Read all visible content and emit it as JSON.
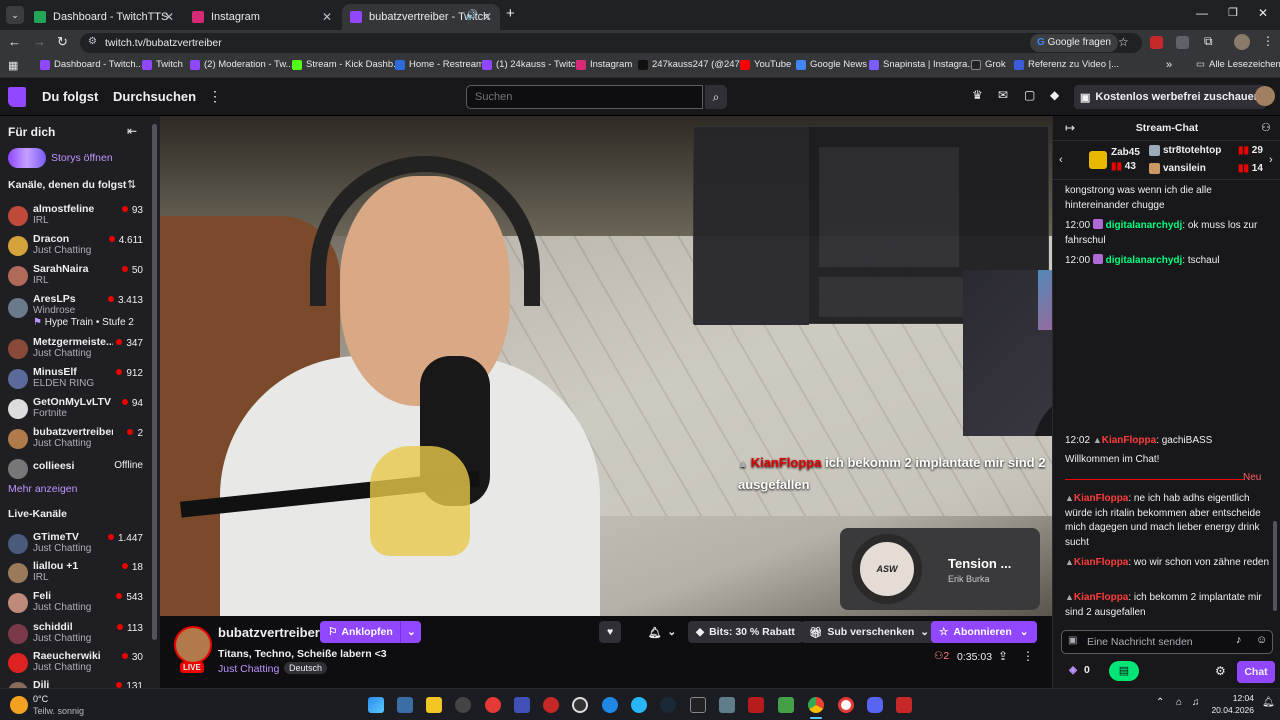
{
  "browser": {
    "tabs": [
      {
        "label": "Dashboard - TwitchTTS",
        "color": "#23a559"
      },
      {
        "label": "Instagram",
        "color": "#d62976"
      },
      {
        "label": "bubatzvertreiber - Twitch",
        "color": "#9146ff"
      }
    ],
    "url": "twitch.tv/bubatzvertreiber",
    "google_button": "Google fragen",
    "bookmarks": [
      {
        "label": "Dashboard - Twitch...",
        "color": "#9146ff"
      },
      {
        "label": "Twitch",
        "color": "#9146ff"
      },
      {
        "label": "(2) Moderation - Tw...",
        "color": "#9146ff"
      },
      {
        "label": "Stream - Kick Dashb...",
        "color": "#53fc18"
      },
      {
        "label": "Home - Restream",
        "color": "#2d6cdf"
      },
      {
        "label": "(1) 24kauss - Twitch",
        "color": "#9146ff"
      },
      {
        "label": "Instagram",
        "color": "#d62976"
      },
      {
        "label": "247kauss247 (@247...",
        "color": "#111111"
      },
      {
        "label": "YouTube",
        "color": "#ff0000"
      },
      {
        "label": "Google News",
        "color": "#4285f4"
      },
      {
        "label": "Snapinsta | Instagra...",
        "color": "#7b5cff"
      },
      {
        "label": "Grok",
        "color": "#222222"
      },
      {
        "label": "Referenz zu Video |...",
        "color": "#3b5bdb"
      }
    ],
    "all_bookmarks": "Alle Lesezeichen"
  },
  "twitch": {
    "nav": {
      "following": "Du folgst",
      "browse": "Durchsuchen",
      "search_placeholder": "Suchen",
      "ad_free": "Kostenlos werbefrei zuschauen"
    },
    "sidebar": {
      "for_you": "Für dich",
      "stories": "Storys öffnen",
      "followed_title": "Kanäle, denen du folgst",
      "followed": [
        {
          "name": "almostfeline",
          "category": "IRL",
          "viewers": "93",
          "color": "#c04a3a"
        },
        {
          "name": "Dracon",
          "category": "Just Chatting",
          "viewers": "4.611",
          "color": "#d4a23a"
        },
        {
          "name": "SarahNaira",
          "category": "IRL",
          "viewers": "50",
          "color": "#b06a5a"
        },
        {
          "name": "AresLPs",
          "category": "Windrose",
          "viewers": "3.413",
          "color": "#6a7a8a",
          "extra": "Hype Train • Stufe 2"
        },
        {
          "name": "Metzgermeiste...",
          "category": "Just Chatting",
          "viewers": "347",
          "color": "#8a4a3a"
        },
        {
          "name": "MinusElf",
          "category": "ELDEN RING",
          "viewers": "912",
          "color": "#5a6a9a"
        },
        {
          "name": "GetOnMyLvLTV",
          "category": "Fortnite",
          "viewers": "94",
          "color": "#dddddd"
        },
        {
          "name": "bubatzvertreiber",
          "category": "Just Chatting",
          "viewers": "2",
          "color": "#b07a4a"
        },
        {
          "name": "collieesi",
          "category": "",
          "viewers": "Offline",
          "color": "#777777"
        }
      ],
      "show_more": "Mehr anzeigen",
      "live_title": "Live-Kanäle",
      "live": [
        {
          "name": "GTimeTV",
          "category": "Just Chatting",
          "viewers": "1.447",
          "color": "#4a5a7a"
        },
        {
          "name": "liallou +1",
          "category": "IRL",
          "viewers": "18",
          "color": "#9a7a5a"
        },
        {
          "name": "Feli",
          "category": "Just Chatting",
          "viewers": "543",
          "color": "#c08a7a"
        },
        {
          "name": "schiddil",
          "category": "Just Chatting",
          "viewers": "113",
          "color": "#7a3a4a"
        },
        {
          "name": "Raeucherwiki",
          "category": "Just Chatting",
          "viewers": "30",
          "color": "#dd2222"
        },
        {
          "name": "Dili",
          "category": "",
          "viewers": "131",
          "color": "#8a6a5a"
        }
      ]
    },
    "video": {
      "overlay_user": "KianFloppa",
      "overlay_msg": "ich bekomm 2 implantate mir sind 2 ausgefallen",
      "song_title": "Tension ...",
      "song_artist": "Erik Burka",
      "song_logo": "ASW"
    },
    "stream": {
      "channel": "bubatzvertreiber",
      "title": "Titans, Techno, Scheiße labern <3",
      "category": "Just Chatting",
      "tag": "Deutsch",
      "live": "LIVE",
      "knock": "Anklopfen",
      "bits": "Bits: 30 % Rabatt",
      "gift": "Sub verschenken",
      "subscribe": "Abonnieren",
      "viewers": "2",
      "uptime": "0:35:03"
    },
    "chat": {
      "title": "Stream-Chat",
      "gifters": [
        {
          "name": "Zab45",
          "count": "43"
        },
        {
          "name": "str8totehtop",
          "count": "29"
        },
        {
          "name": "vansilein",
          "count": "14"
        }
      ],
      "messages_top": [
        {
          "time": "",
          "user": "",
          "text": "kongstrong was wenn ich die alle hintereinander chugge",
          "color": "#efeff1"
        },
        {
          "time": "12:00",
          "user": "digitalanarchydj",
          "text": ": ok muss los zur fahrschul",
          "color": "#00ff7f"
        },
        {
          "time": "12:00",
          "user": "digitalanarchydj",
          "text": ": tschaul",
          "color": "#00ff7f"
        }
      ],
      "msg_1202": {
        "time": "12:02",
        "user": "KianFloppa",
        "text": ": gachiBASS"
      },
      "welcome": "Willkommen im Chat!",
      "new_label": "Neu",
      "messages_bottom": [
        {
          "user": "KianFloppa",
          "text": ": ne ich hab adhs eigentlich würde ich ritalin bekommen aber entscheide mich dagegen und mach lieber energy drink sucht"
        },
        {
          "user": "KianFloppa",
          "text": ": wo wir schon von zähne reden"
        },
        {
          "user": "KianFloppa",
          "text": ": ich bekomm 2 implantate mir sind 2 ausgefallen"
        }
      ],
      "user_color": "#ff3c3c",
      "input_placeholder": "Eine Nachricht senden",
      "points": "0",
      "send": "Chat"
    }
  },
  "taskbar": {
    "weather_temp": "0°C",
    "weather_desc": "Teilw. sonnig",
    "time": "12:04",
    "date": "20.04.2026"
  }
}
